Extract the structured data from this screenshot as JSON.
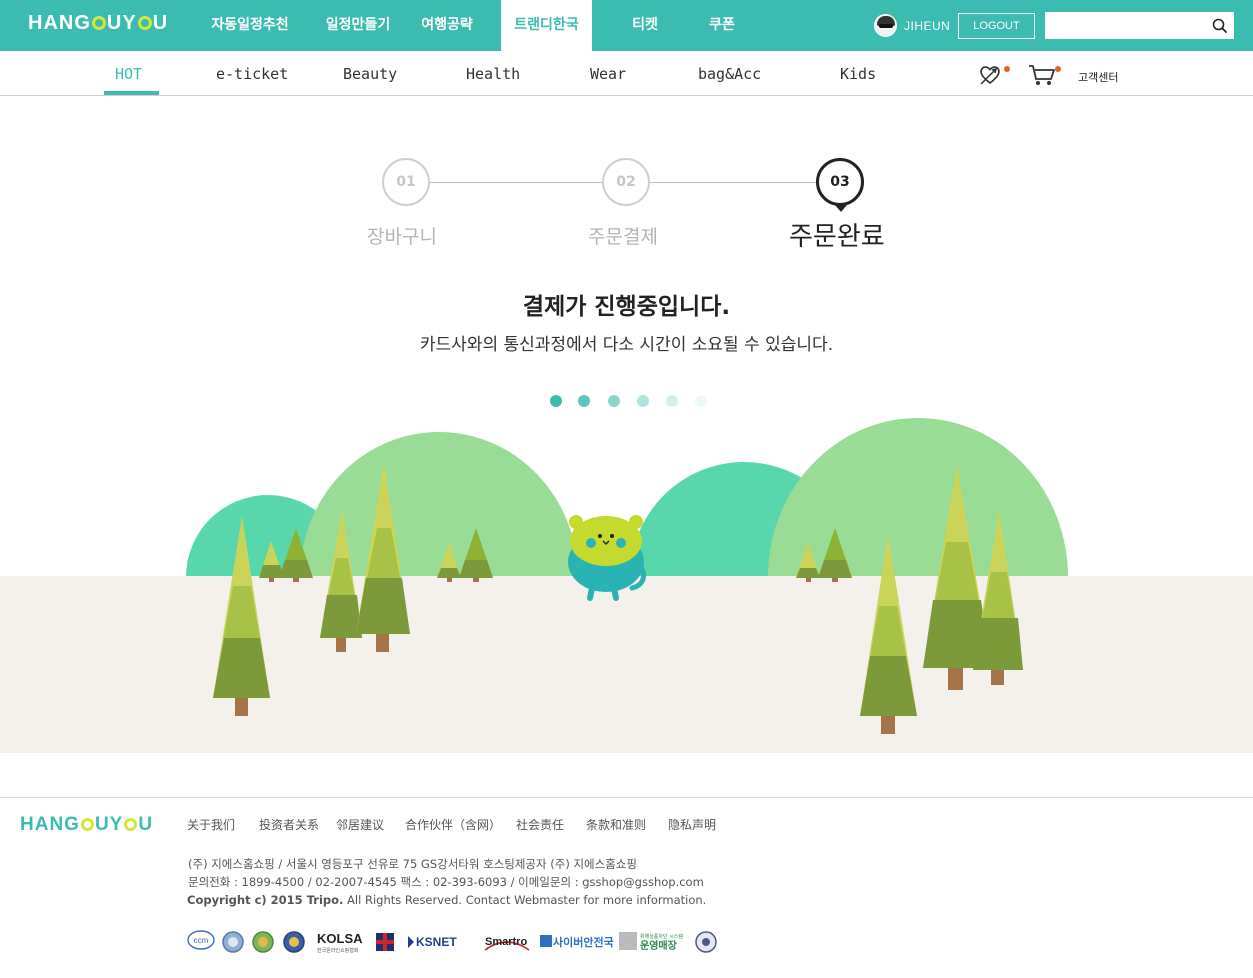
{
  "brand": {
    "logo_pre": "HANG",
    "logo_post": "UY",
    "logo_end": "U"
  },
  "main_nav": [
    {
      "label": "자동일정추천",
      "active": false
    },
    {
      "label": "일정만들기",
      "active": false
    },
    {
      "label": "여행공략",
      "active": false
    },
    {
      "label": "트랜디한국",
      "active": true
    },
    {
      "label": "티켓",
      "active": false
    },
    {
      "label": "쿠폰",
      "active": false
    }
  ],
  "user": {
    "name": "JIHEUN",
    "logout_label": "LOGOUT"
  },
  "search": {
    "placeholder": "",
    "value": ""
  },
  "sub_nav": [
    {
      "label": "HOT",
      "active": true
    },
    {
      "label": "e-ticket",
      "active": false
    },
    {
      "label": "Beauty",
      "active": false
    },
    {
      "label": "Health",
      "active": false
    },
    {
      "label": "Wear",
      "active": false
    },
    {
      "label": "bag&Acc",
      "active": false
    },
    {
      "label": "Kids",
      "active": false
    }
  ],
  "customer_center_label": "고객센터",
  "steps": [
    {
      "num": "01",
      "label": "장바구니",
      "current": false
    },
    {
      "num": "02",
      "label": "주문결제",
      "current": false
    },
    {
      "num": "03",
      "label": "주문완료",
      "current": true
    }
  ],
  "message": {
    "title": "결제가 진행중입니다.",
    "subtitle": "카드사와의 통신과정에서 다소 시간이 소요될 수 있습니다."
  },
  "progress_dots": {
    "count": 6,
    "active": 1
  },
  "colors": {
    "brand_teal": "#3cbcb0",
    "logo_accent": "#d6e635",
    "alert_dot": "#f05a28"
  },
  "footer": {
    "links": [
      "关于我们",
      "投资者关系",
      "邻居建议",
      "合作伙伴（含网）",
      "社会责任",
      "条款和准则",
      "隐私声明"
    ],
    "address": "(주) 지에스홈쇼핑  / 서울시 영등포구 선유로 75 GS강서타워 호스팅제공자 (주) 지에스홈쇼핑",
    "contact": "문의전화 : 1899-4500 / 02-2007-4545 팩스 : 02-393-6093 / 이메일문의 : gsshop@gsshop.com",
    "copyright_bold": "Copyright c) 2015 Tripo.",
    "copyright_rest": " All Rights Reserved. Contact Webmaster for more information.",
    "badges": [
      "ccm",
      "seal-1",
      "seal-2",
      "seal-3",
      "KOLSA",
      "cross",
      "KSNET",
      "Smartro",
      "사이버안전국",
      "운영매장",
      "seal-4"
    ],
    "badge_texts": {
      "ccm": "ccm",
      "kolsa": "KOLSA",
      "kolsa_sub": "한국온라인쇼핑협회",
      "ksnet": "KSNET",
      "smartro": "Smartro",
      "cyber": "사이버안전국",
      "store_top": "위해상품차단 시스템",
      "store": "운영매장"
    }
  }
}
